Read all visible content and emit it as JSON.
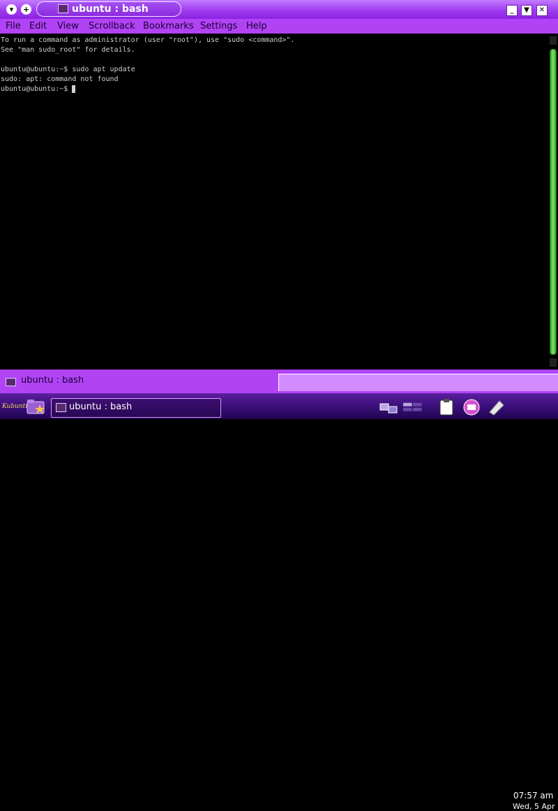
{
  "window": {
    "title": "ubuntu : bash",
    "buttons": [
      "▾",
      "+"
    ]
  },
  "menu": {
    "items": [
      "File",
      "Edit",
      "View",
      "Scrollback",
      "Bookmarks",
      "Settings",
      "Help"
    ]
  },
  "terminal": {
    "lines": [
      "To run a command as administrator (user \"root\"), use \"sudo <command>\".",
      "See \"man sudo_root\" for details.",
      "",
      "ubuntu@ubuntu:~$ sudo apt update",
      "sudo: apt: command not found",
      "ubuntu@ubuntu:~$ "
    ]
  },
  "tabs": [
    {
      "label": "ubuntu : bash",
      "active": true
    }
  ],
  "taskbar": {
    "task_label": "ubuntu : bash",
    "clock_time": "07:57 am",
    "clock_date": "Wed, 5 Apr",
    "tray_icons": [
      "network-icon",
      "klipper-icon",
      "document-icon",
      "printer-icon",
      "package-icon"
    ]
  },
  "colors": {
    "accent": "#b143f5",
    "titlebar": "#9f3cf0",
    "panel": "#3b0f7a",
    "scrollbar_thumb": "#4fc94a"
  }
}
